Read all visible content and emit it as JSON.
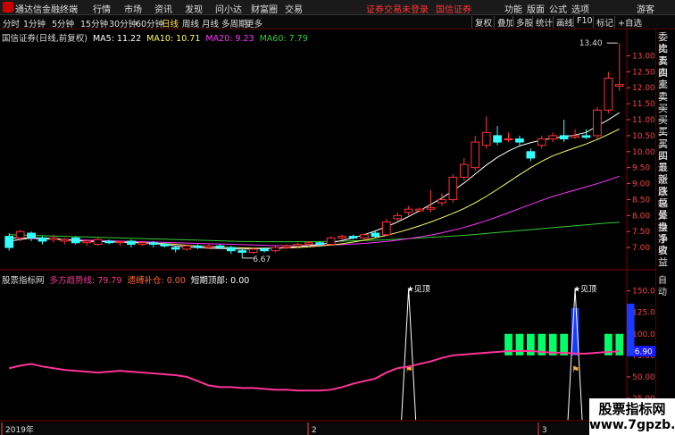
{
  "menubar": {
    "app_title": "通达信金融终端",
    "menus": [
      "行情",
      "市场",
      "资讯",
      "发现",
      "问小达",
      "财富圈",
      "交易"
    ],
    "status_left": "证券交易未登录",
    "broker": "国信证券",
    "menus_right": [
      "功能",
      "版面",
      "公式",
      "选项"
    ],
    "user": "游客"
  },
  "toolbar": {
    "periods": [
      "分时",
      "1分钟",
      "5分钟",
      "15分钟",
      "30分钟",
      "60分钟",
      "日线",
      "周线",
      "月线",
      "多周期",
      "更多"
    ],
    "active_period": "日线",
    "right_buttons": [
      "复权",
      "叠加",
      "多股",
      "统计",
      "画线",
      "F10",
      "标记",
      "+自选"
    ]
  },
  "main_legend": {
    "title": "国信证券(日线,前复权)",
    "ma5": "MA5: 11.22",
    "ma10": "MA10: 10.71",
    "ma20": "MA20: 9.23",
    "ma60": "MA60: 7.79",
    "colors": {
      "ma5": "#ffffff",
      "ma10": "#ffff66",
      "ma20": "#ff33ff",
      "ma60": "#33cc33"
    }
  },
  "main_axis": [
    "13.00",
    "12.50",
    "12.00",
    "11.50",
    "11.00",
    "10.50",
    "10.00",
    "9.50",
    "9.00",
    "8.50",
    "8.00",
    "7.50",
    "7.00"
  ],
  "high_mark": "13.40",
  "low_mark": "6.67",
  "indicator_legend": {
    "name": "股票指标网",
    "line1": "多方趋势线: 79.79",
    "line2": "遗缚补仓: 0.00",
    "line3": "短期顶部: 0.00"
  },
  "indicator_axis": [
    "150.00",
    "125.00",
    "100.00",
    "75.00",
    "50.00",
    "25.00"
  ],
  "indicator_current": "76.90",
  "top_signal": "见顶",
  "dates": [
    "2019年",
    "2",
    "3"
  ],
  "right_panel": {
    "top": [
      "委比",
      "卖五",
      "卖四",
      "卖三",
      "卖二",
      "卖一",
      "买一",
      "买二",
      "买三",
      "买四",
      "买五",
      "最新",
      "涨跌",
      "涨幅",
      "总量",
      "外盘",
      "换手",
      "净资",
      "收益"
    ],
    "bottom": [
      "自动"
    ]
  },
  "chart_data": {
    "type": "candlestick",
    "up_color": "#ff3333",
    "down_color": "#33ffff",
    "candles": [
      {
        "o": 7.35,
        "c": 7.0,
        "h": 7.45,
        "l": 6.9
      },
      {
        "o": 7.3,
        "c": 7.5,
        "h": 7.55,
        "l": 7.2
      },
      {
        "o": 7.45,
        "c": 7.3,
        "h": 7.5,
        "l": 7.2
      },
      {
        "o": 7.3,
        "c": 7.2,
        "h": 7.35,
        "l": 7.1
      },
      {
        "o": 7.25,
        "c": 7.3,
        "h": 7.4,
        "l": 7.15
      },
      {
        "o": 7.2,
        "c": 7.25,
        "h": 7.3,
        "l": 7.1
      },
      {
        "o": 7.3,
        "c": 7.15,
        "h": 7.35,
        "l": 7.1
      },
      {
        "o": 7.15,
        "c": 7.2,
        "h": 7.25,
        "l": 7.05
      },
      {
        "o": 7.1,
        "c": 7.25,
        "h": 7.3,
        "l": 7.05
      },
      {
        "o": 7.2,
        "c": 7.15,
        "h": 7.25,
        "l": 7.1
      },
      {
        "o": 7.15,
        "c": 7.18,
        "h": 7.22,
        "l": 7.05
      },
      {
        "o": 7.2,
        "c": 7.1,
        "h": 7.25,
        "l": 7.0
      },
      {
        "o": 7.1,
        "c": 7.15,
        "h": 7.2,
        "l": 7.05
      },
      {
        "o": 7.15,
        "c": 7.1,
        "h": 7.2,
        "l": 7.0
      },
      {
        "o": 7.1,
        "c": 7.05,
        "h": 7.15,
        "l": 7.0
      },
      {
        "o": 7.0,
        "c": 6.95,
        "h": 7.05,
        "l": 6.85
      },
      {
        "o": 6.95,
        "c": 7.05,
        "h": 7.1,
        "l": 6.9
      },
      {
        "o": 7.05,
        "c": 7.0,
        "h": 7.1,
        "l": 6.95
      },
      {
        "o": 7.0,
        "c": 7.05,
        "h": 7.1,
        "l": 6.95
      },
      {
        "o": 7.05,
        "c": 7.0,
        "h": 7.1,
        "l": 6.95
      },
      {
        "o": 7.0,
        "c": 6.9,
        "h": 7.05,
        "l": 6.8
      },
      {
        "o": 6.9,
        "c": 6.85,
        "h": 6.95,
        "l": 6.67
      },
      {
        "o": 6.85,
        "c": 6.95,
        "h": 7.0,
        "l": 6.8
      },
      {
        "o": 6.95,
        "c": 6.9,
        "h": 7.0,
        "l": 6.85
      },
      {
        "o": 6.9,
        "c": 7.0,
        "h": 7.05,
        "l": 6.85
      },
      {
        "o": 7.0,
        "c": 7.05,
        "h": 7.1,
        "l": 6.95
      },
      {
        "o": 7.05,
        "c": 7.1,
        "h": 7.15,
        "l": 7.0
      },
      {
        "o": 7.1,
        "c": 7.15,
        "h": 7.2,
        "l": 7.05
      },
      {
        "o": 7.15,
        "c": 7.1,
        "h": 7.2,
        "l": 7.05
      },
      {
        "o": 7.1,
        "c": 7.3,
        "h": 7.35,
        "l": 7.05
      },
      {
        "o": 7.3,
        "c": 7.35,
        "h": 7.4,
        "l": 7.25
      },
      {
        "o": 7.35,
        "c": 7.3,
        "h": 7.4,
        "l": 7.25
      },
      {
        "o": 7.3,
        "c": 7.4,
        "h": 7.45,
        "l": 7.25
      },
      {
        "o": 7.45,
        "c": 7.35,
        "h": 7.5,
        "l": 7.3
      },
      {
        "o": 7.4,
        "c": 7.8,
        "h": 7.9,
        "l": 7.35
      },
      {
        "o": 7.9,
        "c": 8.0,
        "h": 8.1,
        "l": 7.8
      },
      {
        "o": 8.1,
        "c": 8.2,
        "h": 8.3,
        "l": 8.0
      },
      {
        "o": 8.15,
        "c": 8.2,
        "h": 8.25,
        "l": 8.1
      },
      {
        "o": 8.2,
        "c": 8.25,
        "h": 8.8,
        "l": 8.1
      },
      {
        "o": 8.4,
        "c": 8.5,
        "h": 8.7,
        "l": 8.3
      },
      {
        "o": 8.5,
        "c": 9.2,
        "h": 9.3,
        "l": 8.4
      },
      {
        "o": 9.2,
        "c": 9.6,
        "h": 9.8,
        "l": 9.1
      },
      {
        "o": 9.5,
        "c": 10.3,
        "h": 10.5,
        "l": 9.4
      },
      {
        "o": 10.2,
        "c": 10.6,
        "h": 11.1,
        "l": 10.1
      },
      {
        "o": 10.5,
        "c": 10.3,
        "h": 10.8,
        "l": 10.2
      },
      {
        "o": 10.4,
        "c": 10.4,
        "h": 10.6,
        "l": 10.3
      },
      {
        "o": 10.4,
        "c": 10.3,
        "h": 10.5,
        "l": 10.2
      },
      {
        "o": 10.0,
        "c": 9.8,
        "h": 10.1,
        "l": 9.7
      },
      {
        "o": 10.2,
        "c": 10.4,
        "h": 10.5,
        "l": 10.1
      },
      {
        "o": 10.4,
        "c": 10.5,
        "h": 10.6,
        "l": 10.3
      },
      {
        "o": 10.5,
        "c": 10.4,
        "h": 11.0,
        "l": 10.3
      },
      {
        "o": 10.45,
        "c": 10.5,
        "h": 10.7,
        "l": 10.4
      },
      {
        "o": 10.5,
        "c": 10.45,
        "h": 10.7,
        "l": 10.4
      },
      {
        "o": 10.5,
        "c": 11.3,
        "h": 11.4,
        "l": 10.4
      },
      {
        "o": 11.3,
        "c": 12.3,
        "h": 12.5,
        "l": 11.2
      },
      {
        "o": 12.05,
        "c": 12.1,
        "h": 13.4,
        "l": 11.9
      }
    ],
    "ma5": [
      7.2,
      7.25,
      7.3,
      7.3,
      7.28,
      7.25,
      7.22,
      7.2,
      7.19,
      7.18,
      7.17,
      7.16,
      7.15,
      7.13,
      7.1,
      7.05,
      7.02,
      7.0,
      6.98,
      6.97,
      6.96,
      6.95,
      6.96,
      6.97,
      6.98,
      7.0,
      7.03,
      7.06,
      7.1,
      7.15,
      7.22,
      7.3,
      7.4,
      7.52,
      7.65,
      7.8,
      7.97,
      8.15,
      8.35,
      8.55,
      8.78,
      9.02,
      9.3,
      9.58,
      9.82,
      10.02,
      10.18,
      10.28,
      10.36,
      10.42,
      10.47,
      10.52,
      10.6,
      10.8,
      11.0,
      11.22
    ],
    "ma10": [
      7.3,
      7.3,
      7.3,
      7.28,
      7.26,
      7.24,
      7.22,
      7.2,
      7.19,
      7.18,
      7.17,
      7.16,
      7.15,
      7.14,
      7.12,
      7.1,
      7.07,
      7.05,
      7.03,
      7.01,
      7.0,
      6.99,
      6.98,
      6.98,
      6.98,
      6.99,
      7.0,
      7.02,
      7.05,
      7.08,
      7.12,
      7.17,
      7.23,
      7.3,
      7.38,
      7.47,
      7.57,
      7.68,
      7.8,
      7.93,
      8.07,
      8.22,
      8.4,
      8.6,
      8.82,
      9.05,
      9.28,
      9.5,
      9.7,
      9.87,
      10.0,
      10.12,
      10.24,
      10.38,
      10.54,
      10.71
    ],
    "ma20": [
      7.3,
      7.29,
      7.28,
      7.27,
      7.26,
      7.25,
      7.24,
      7.23,
      7.22,
      7.21,
      7.2,
      7.19,
      7.18,
      7.17,
      7.16,
      7.15,
      7.14,
      7.13,
      7.12,
      7.11,
      7.1,
      7.09,
      7.08,
      7.07,
      7.06,
      7.06,
      7.06,
      7.06,
      7.07,
      7.08,
      7.09,
      7.11,
      7.13,
      7.16,
      7.19,
      7.23,
      7.28,
      7.33,
      7.39,
      7.46,
      7.54,
      7.63,
      7.73,
      7.84,
      7.96,
      8.09,
      8.22,
      8.35,
      8.48,
      8.6,
      8.7,
      8.8,
      8.9,
      9.0,
      9.11,
      9.23
    ],
    "ma60": [
      7.4,
      7.39,
      7.38,
      7.37,
      7.36,
      7.35,
      7.34,
      7.33,
      7.32,
      7.31,
      7.3,
      7.29,
      7.28,
      7.27,
      7.26,
      7.25,
      7.24,
      7.23,
      7.22,
      7.21,
      7.2,
      7.19,
      7.19,
      7.18,
      7.18,
      7.18,
      7.18,
      7.18,
      7.19,
      7.19,
      7.2,
      7.21,
      7.22,
      7.23,
      7.24,
      7.26,
      7.28,
      7.3,
      7.32,
      7.34,
      7.36,
      7.38,
      7.41,
      7.44,
      7.47,
      7.5,
      7.53,
      7.56,
      7.59,
      7.62,
      7.65,
      7.68,
      7.71,
      7.74,
      7.77,
      7.79
    ],
    "trend_line": [
      60,
      63,
      65,
      62,
      60,
      58,
      57,
      56,
      55,
      56,
      57,
      56,
      55,
      54,
      53,
      52,
      50,
      45,
      40,
      38,
      38,
      37,
      37,
      36,
      35,
      35,
      34,
      34,
      34,
      35,
      38,
      42,
      45,
      48,
      55,
      60,
      62,
      65,
      68,
      72,
      75,
      76,
      77,
      78,
      79,
      80,
      80,
      80,
      79,
      78,
      78,
      77,
      77,
      78,
      79,
      79.79
    ],
    "bars": [
      {
        "i": 45,
        "v": 100
      },
      {
        "i": 46,
        "v": 100
      },
      {
        "i": 47,
        "v": 100
      },
      {
        "i": 48,
        "v": 100
      },
      {
        "i": 49,
        "v": 100
      },
      {
        "i": 50,
        "v": 100
      },
      {
        "i": 51,
        "v": 100
      },
      {
        "i": 54,
        "v": 100
      },
      {
        "i": 55,
        "v": 100
      }
    ],
    "blue_bars": [
      {
        "i": 51,
        "v": 130
      },
      {
        "i": 56,
        "v": 135
      }
    ],
    "peaks": [
      {
        "i": 36,
        "label": "见顶"
      },
      {
        "i": 51,
        "label": "见顶"
      }
    ],
    "ylim_main": [
      6.5,
      13.6
    ],
    "ylim_ind": [
      0,
      160
    ]
  }
}
